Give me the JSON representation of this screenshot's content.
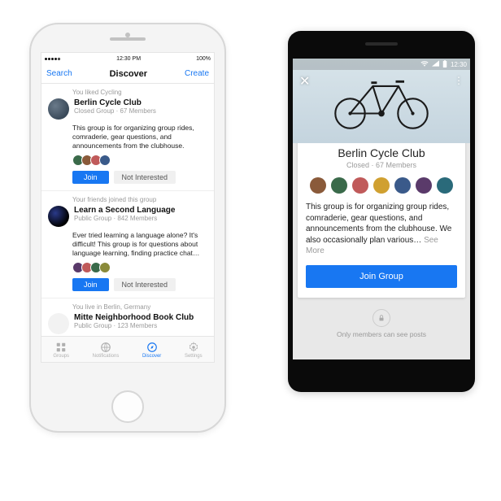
{
  "iphone": {
    "statusbar": {
      "carrier": "•••••",
      "time": "12:30 PM",
      "battery": "100%"
    },
    "nav": {
      "left": "Search",
      "title": "Discover",
      "right": "Create"
    },
    "cards": [
      {
        "reason": "You liked Cycling",
        "name": "Berlin Cycle Club",
        "meta": "Closed Group · 67 Members",
        "desc": "This group is for organizing group rides, comraderie, gear questions, and announcements from the clubhouse.",
        "join": "Join",
        "not": "Not Interested"
      },
      {
        "reason": "Your friends joined this group",
        "name": "Learn a Second Language",
        "meta": "Public Group · 842 Members",
        "desc": "Ever tried learning a language alone? It's difficult! This group is for questions about language learning, finding practice chat…",
        "join": "Join",
        "not": "Not Interested"
      },
      {
        "reason": "You live in Berlin, Germany",
        "name": "Mitte Neighborhood Book Club",
        "meta": "Public Group · 123 Members"
      }
    ],
    "tabs": [
      "Groups",
      "Notifications",
      "Discover",
      "Settings"
    ]
  },
  "android": {
    "statusbar": {
      "time": "12:30"
    },
    "group": {
      "title": "Berlin Cycle Club",
      "meta": "Closed · 67 Members",
      "desc": "This group is for organizing group rides, comraderie, gear questions, and announcements from the clubhouse. We also occasionally plan various…",
      "seemore": " See More",
      "join": "Join Group"
    },
    "privacy": "Only members can see posts"
  },
  "colors": {
    "accent": "#1877f2",
    "faces": [
      "#3a6a4a",
      "#8a5a3a",
      "#c05a5a",
      "#3a5a8a",
      "#5a3a6a",
      "#8a8a3a",
      "#2a6a7a"
    ]
  }
}
